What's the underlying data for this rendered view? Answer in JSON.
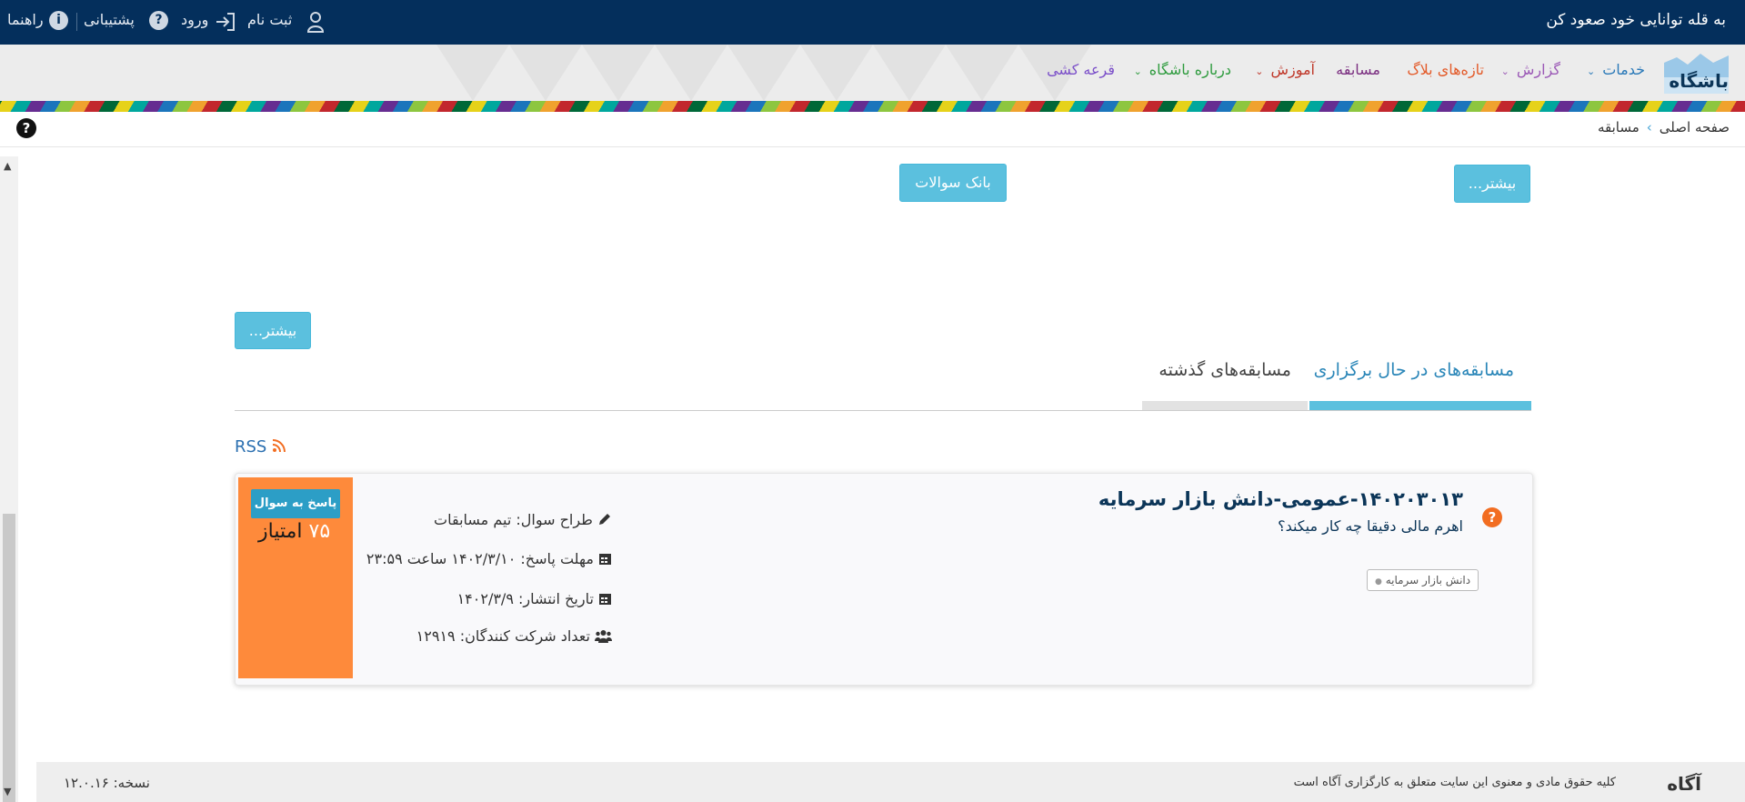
{
  "header": {
    "slogan": "به قله توانایی خود صعود کن",
    "links": {
      "register": "ثبت نام",
      "login": "ورود",
      "support": "پشتیبانی",
      "guide": "راهنما"
    }
  },
  "nav": {
    "logo_text": "باشگاه",
    "items": {
      "services": "خدمات",
      "report": "گزارش",
      "blog": "تازه‌های بلاگ",
      "contest": "مسابقه",
      "education": "آموزش",
      "about": "درباره باشگاه",
      "lottery": "قرعه کشی"
    }
  },
  "breadcrumb": {
    "home": "صفحه اصلی",
    "separator": "›",
    "current": "مسابقه"
  },
  "buttons": {
    "more": "بیشتر...",
    "question_bank": "بانک سوالات",
    "more_2": "بیشتر..."
  },
  "tabs": {
    "active": "مسابقه‌های در حال برگزاری",
    "past": "مسابقه‌های گذشته"
  },
  "rss_label": "RSS",
  "contest": {
    "title": "۱۴۰۲۰۳۰۱۳-عمومی-دانش بازار سرمایه",
    "subtitle": "اهرم مالی دقیقا چه کار میکند؟",
    "tag": "دانش بازار سرمایه",
    "designer": "طراح سوال: تیم مسابقات",
    "deadline": "مهلت پاسخ: ۱۴۰۲/۳/۱۰ ساعت ۲۳:۵۹",
    "publish_date": "تاریخ انتشار: ۱۴۰۲/۳/۹",
    "participants": "تعداد شرکت کنندگان: ۱۲۹۱۹",
    "answer_button": "پاسخ به سوال",
    "score_value": "۷۵",
    "score_unit": "امتیاز"
  },
  "footer": {
    "logo": "آگاه",
    "copyright": "کلیه حقوق مادی و معنوی این سایت متعلق به کارگزاری آگاه است",
    "version": "نسخه: ۱۲.۰.۱۶"
  },
  "colors": {
    "topbar": "#042f5c",
    "accent_blue": "#5bc0de",
    "score_orange": "#fe8a3b",
    "title_navy": "#0b3558"
  }
}
